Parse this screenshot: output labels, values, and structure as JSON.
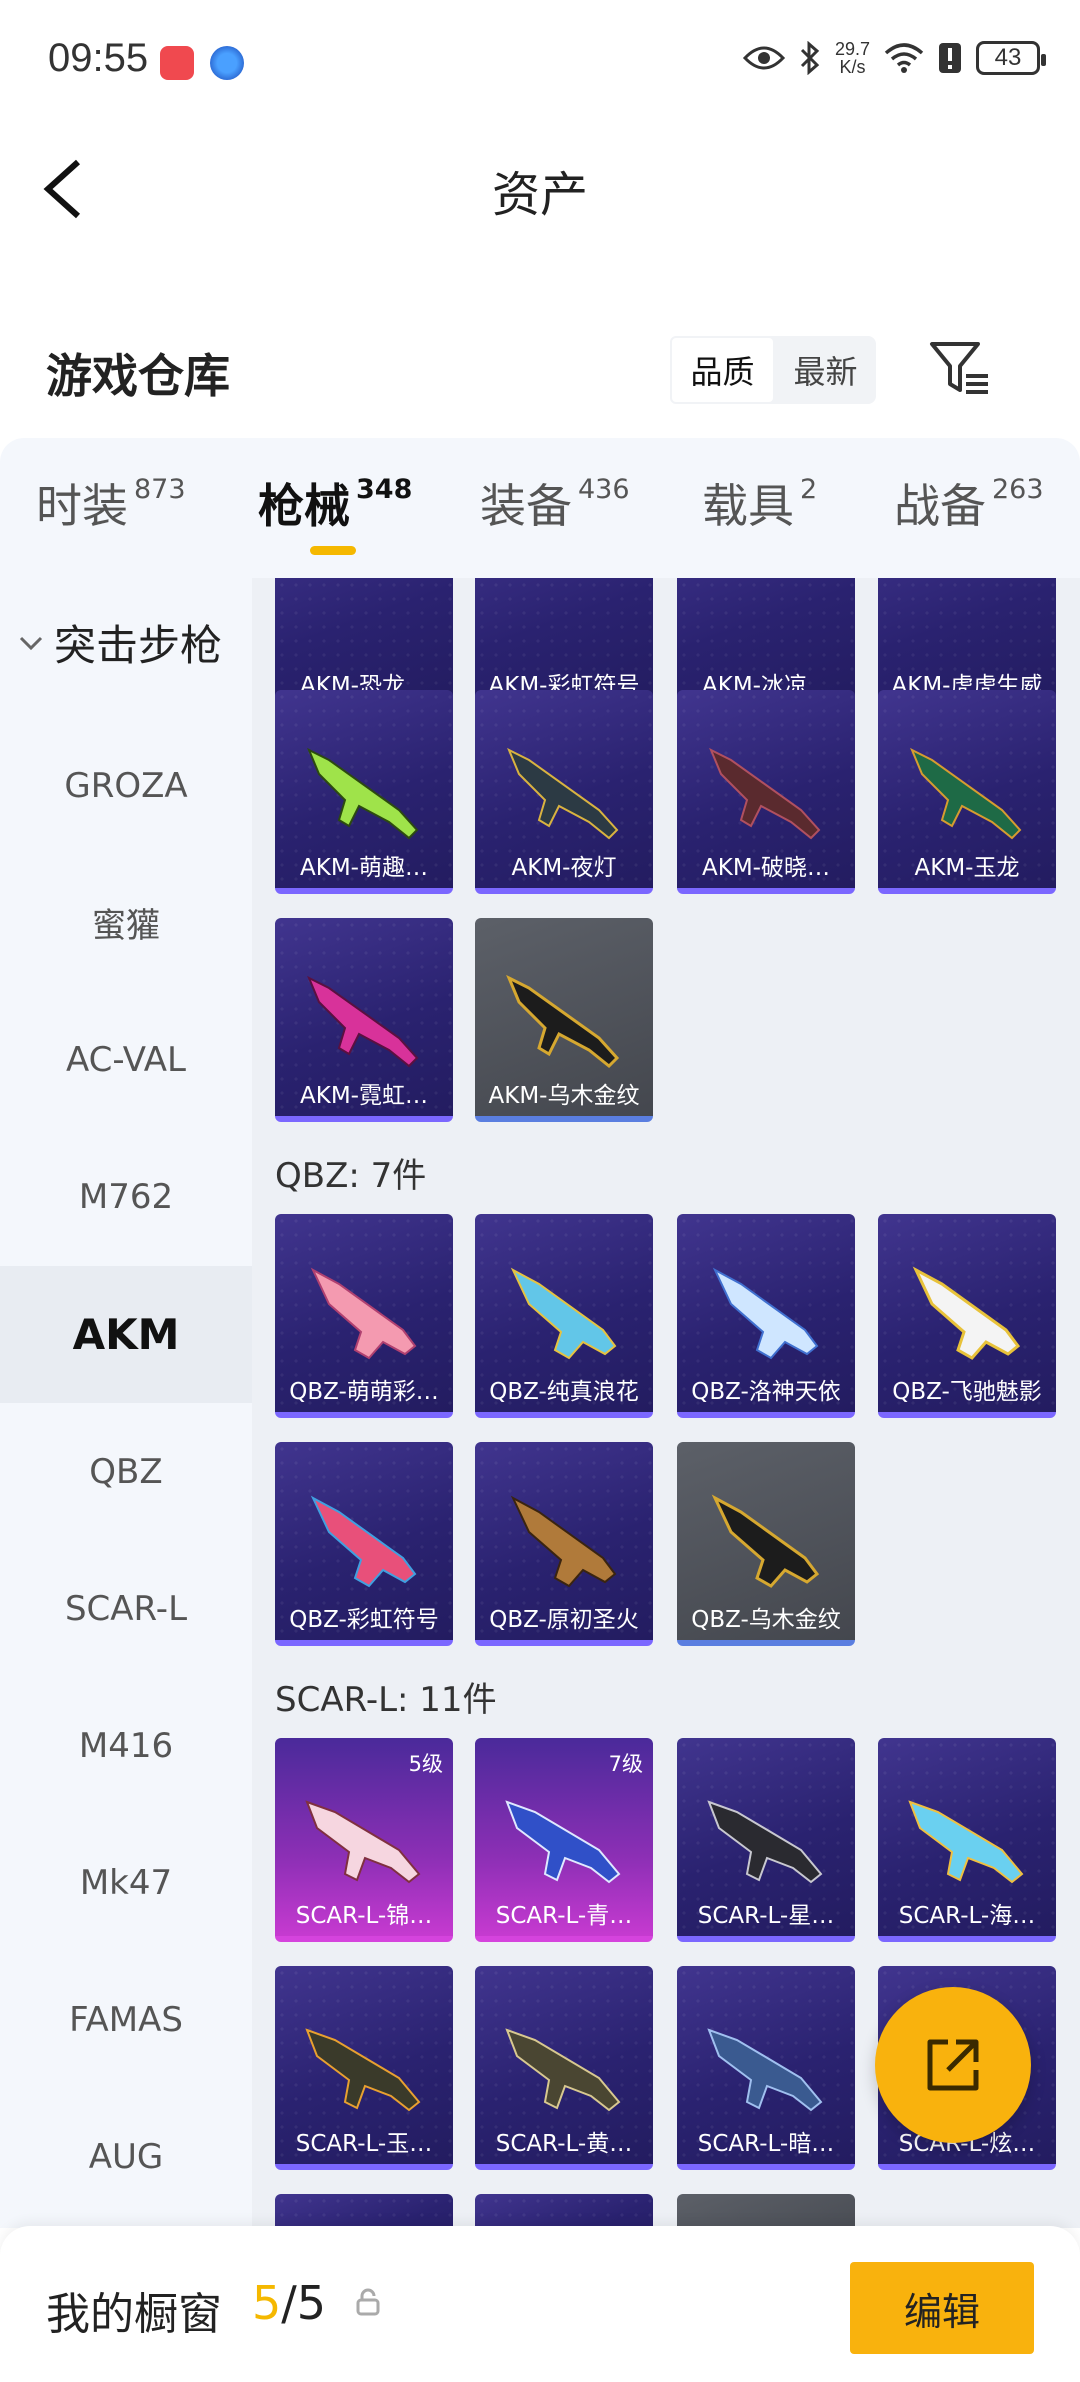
{
  "status_bar": {
    "time": "09:55",
    "speed_value": "29.7",
    "speed_unit": "K/s",
    "battery": "43"
  },
  "header": {
    "title": "资产"
  },
  "warehouse": {
    "title": "游戏仓库",
    "sort_options": [
      "品质",
      "最新"
    ],
    "sort_selected": "品质"
  },
  "tabs": [
    {
      "label": "时装",
      "count": "873"
    },
    {
      "label": "枪械",
      "count": "348",
      "active": true
    },
    {
      "label": "装备",
      "count": "436"
    },
    {
      "label": "载具",
      "count": "2"
    },
    {
      "label": "战备",
      "count": "263"
    }
  ],
  "sidebar": {
    "category": "突击步枪",
    "items": [
      "GROZA",
      "蜜獾",
      "AC-VAL",
      "M762",
      "AKM",
      "QBZ",
      "SCAR-L",
      "M416",
      "Mk47",
      "FAMAS",
      "AUG"
    ],
    "active": "AKM"
  },
  "sections": {
    "akm": {
      "cards_row0": [
        "AKM-恐龙…",
        "AKM-彩虹符号",
        "AKM-冰凉…",
        "AKM-虎虎生威"
      ],
      "cards_row1": [
        "AKM-萌趣…",
        "AKM-夜灯",
        "AKM-破晓…",
        "AKM-玉龙"
      ],
      "cards_row2": [
        "AKM-霓虹…",
        "AKM-乌木金纹"
      ]
    },
    "qbz": {
      "label": "QBZ: 7件",
      "cards_row0": [
        "QBZ-萌萌彩…",
        "QBZ-纯真浪花",
        "QBZ-洛神天依",
        "QBZ-飞驰魅影"
      ],
      "cards_row1": [
        "QBZ-彩虹符号",
        "QBZ-原初圣火",
        "QBZ-乌木金纹"
      ]
    },
    "scar": {
      "label": "SCAR-L: 11件",
      "cards_row0": [
        "SCAR-L-锦…",
        "SCAR-L-青…",
        "SCAR-L-星…",
        "SCAR-L-海…"
      ],
      "levels": [
        "5级",
        "7级"
      ],
      "cards_row1": [
        "SCAR-L-玉…",
        "SCAR-L-黄…",
        "SCAR-L-暗…",
        "SCAR-L-炫…"
      ]
    }
  },
  "bottom_bar": {
    "label": "我的橱窗",
    "current": "5",
    "separator": "/",
    "total": "5",
    "edit_label": "编辑"
  },
  "colors": {
    "accent": "#f9b20d",
    "card_purple": "#2a2270",
    "card_pink": "#c63ad0",
    "card_gray": "#4a4d55"
  }
}
